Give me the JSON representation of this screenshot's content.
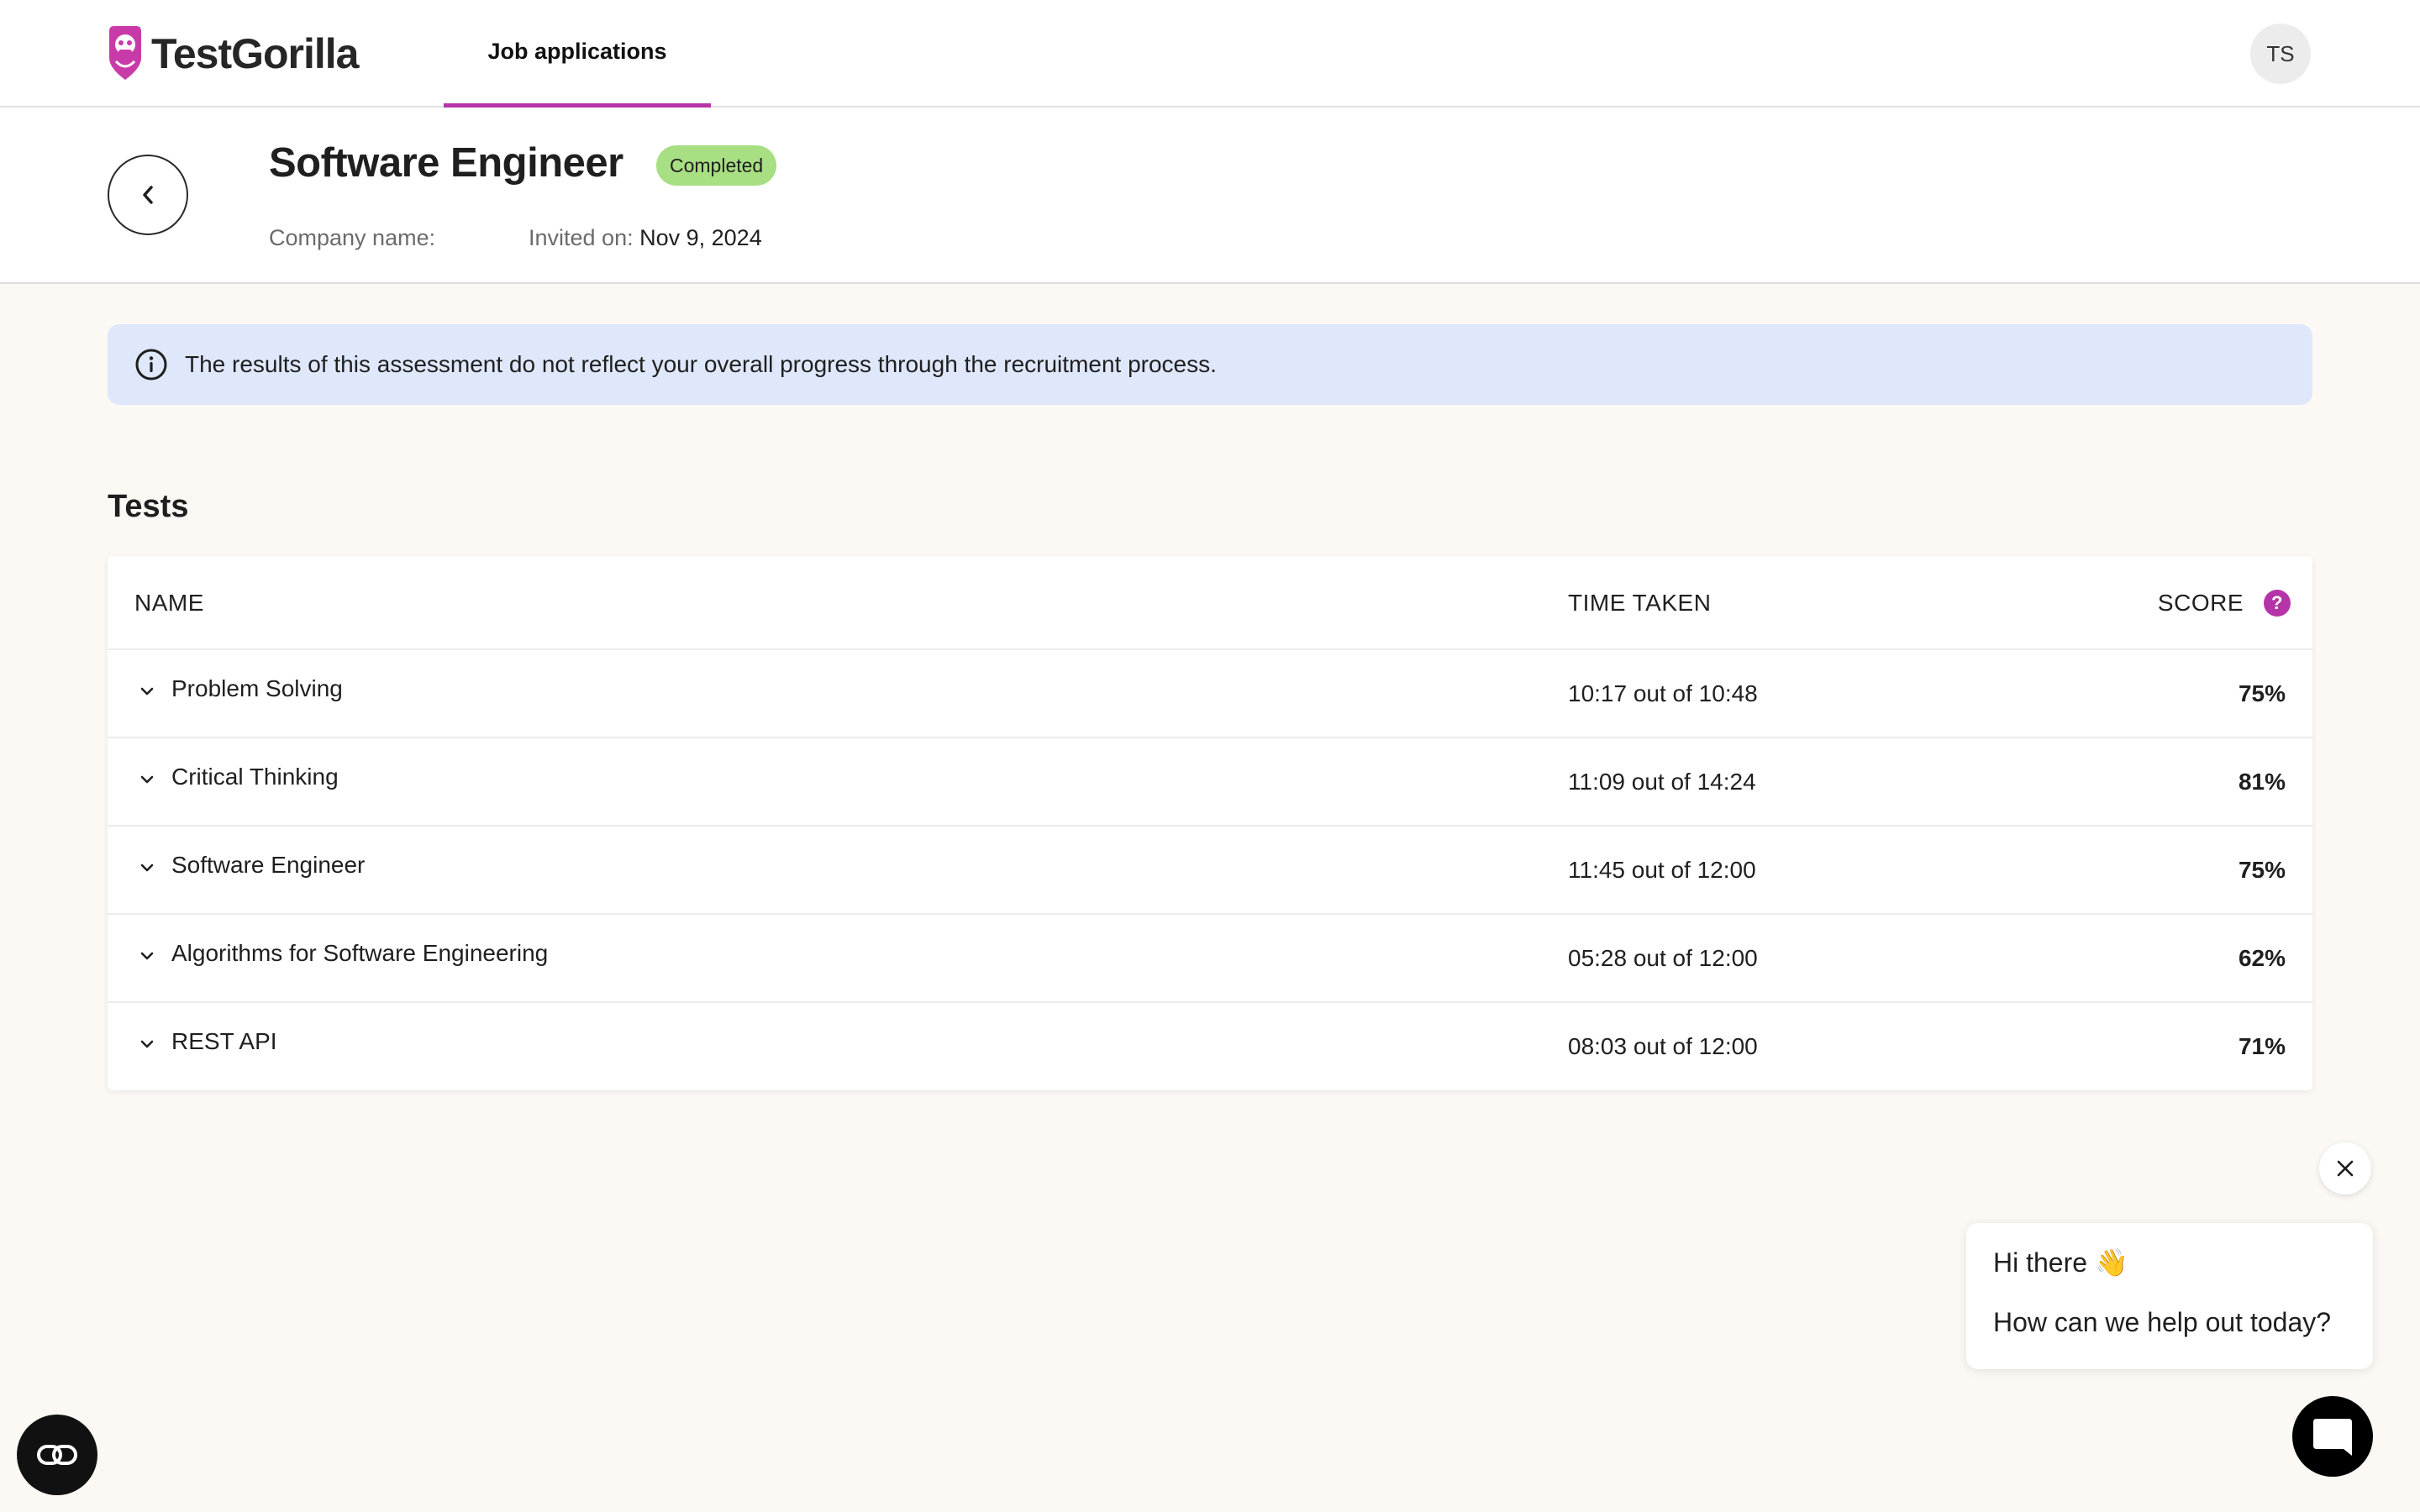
{
  "nav": {
    "brand": "TestGorilla",
    "tab_label": "Job applications",
    "avatar_initials": "TS",
    "accent_color": "#b535a8"
  },
  "header": {
    "title": "Software Engineer",
    "status": "Completed",
    "status_color": "#a7df82",
    "company_label": "Company name:",
    "company_value": "",
    "invited_label": "Invited on:",
    "invited_value": "Nov 9, 2024"
  },
  "banner": {
    "icon": "info-icon",
    "text": "The results of this assessment do not reflect your overall progress through the recruitment process."
  },
  "tests": {
    "section_title": "Tests",
    "columns": {
      "name": "NAME",
      "time": "TIME TAKEN",
      "score": "SCORE"
    },
    "help_glyph": "?",
    "rows": [
      {
        "name": "Problem Solving",
        "time": "10:17 out of 10:48",
        "score": "75%"
      },
      {
        "name": "Critical Thinking",
        "time": "11:09 out of 14:24",
        "score": "81%"
      },
      {
        "name": "Software Engineer",
        "time": "11:45 out of 12:00",
        "score": "75%"
      },
      {
        "name": "Algorithms for Software Engineering",
        "time": "05:28 out of 12:00",
        "score": "62%"
      },
      {
        "name": "REST API",
        "time": "08:03 out of 12:00",
        "score": "71%"
      }
    ]
  },
  "chat": {
    "greeting": "Hi there 👋",
    "prompt": "How can we help out today?"
  }
}
